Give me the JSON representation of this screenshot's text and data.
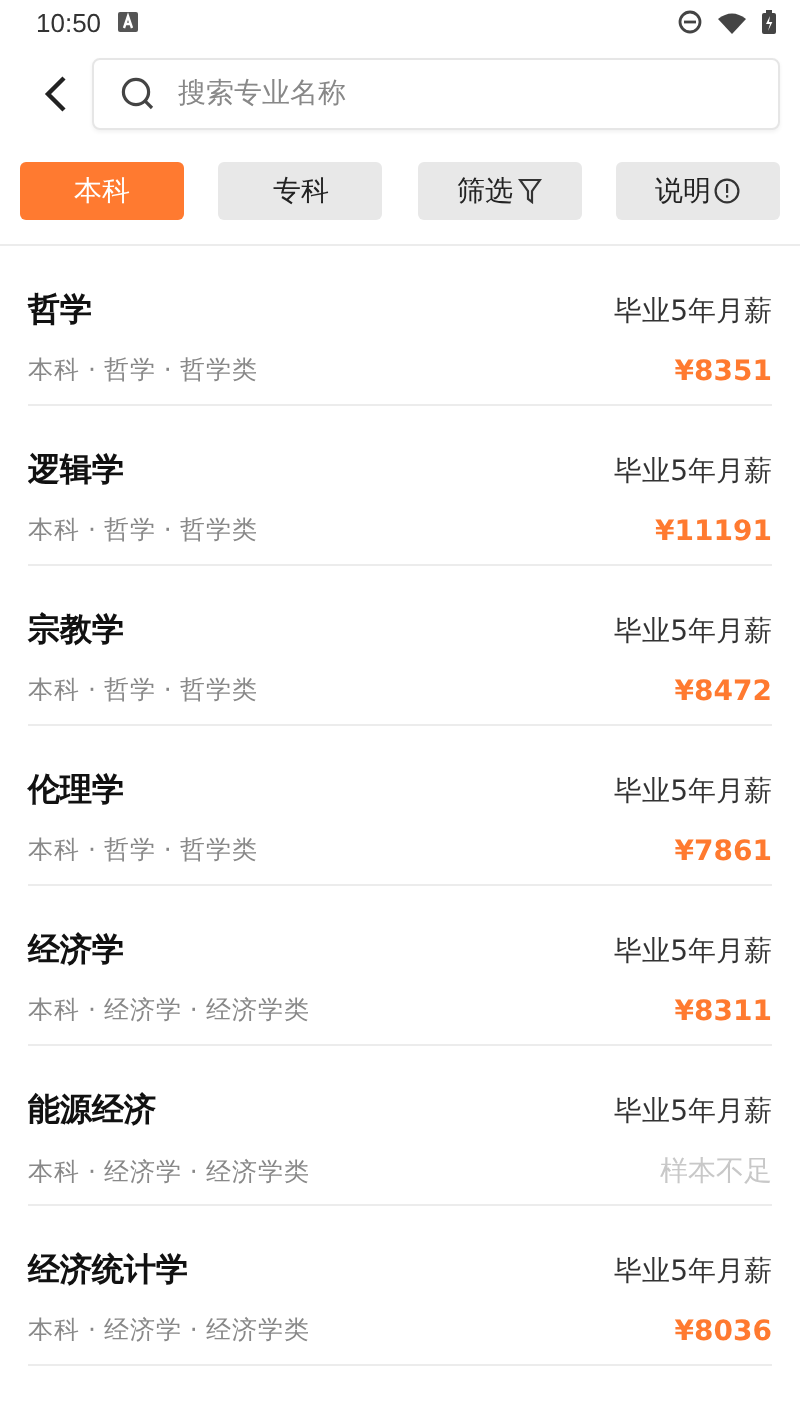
{
  "status_bar": {
    "time": "10:50"
  },
  "search": {
    "placeholder": "搜索专业名称"
  },
  "tabs": [
    {
      "label": "本科",
      "selected": true
    },
    {
      "label": "专科",
      "selected": false
    }
  ],
  "actions": [
    {
      "label": "筛选",
      "kind": "filter"
    },
    {
      "label": "说明",
      "kind": "info"
    }
  ],
  "majors": [
    {
      "name": "哲学",
      "path": "本科 · 哲学 · 哲学类",
      "salary_label": "毕业5年月薪",
      "salary": "¥8351",
      "kind": "amount"
    },
    {
      "name": "逻辑学",
      "path": "本科 · 哲学 · 哲学类",
      "salary_label": "毕业5年月薪",
      "salary": "¥11191",
      "kind": "amount"
    },
    {
      "name": "宗教学",
      "path": "本科 · 哲学 · 哲学类",
      "salary_label": "毕业5年月薪",
      "salary": "¥8472",
      "kind": "amount"
    },
    {
      "name": "伦理学",
      "path": "本科 · 哲学 · 哲学类",
      "salary_label": "毕业5年月薪",
      "salary": "¥7861",
      "kind": "amount"
    },
    {
      "name": "经济学",
      "path": "本科 · 经济学 · 经济学类",
      "salary_label": "毕业5年月薪",
      "salary": "¥8311",
      "kind": "amount"
    },
    {
      "name": "能源经济",
      "path": "本科 · 经济学 · 经济学类",
      "salary_label": "毕业5年月薪",
      "salary": "样本不足",
      "kind": "insufficient"
    },
    {
      "name": "经济统计学",
      "path": "本科 · 经济学 · 经济学类",
      "salary_label": "毕业5年月薪",
      "salary": "¥8036",
      "kind": "amount"
    }
  ]
}
